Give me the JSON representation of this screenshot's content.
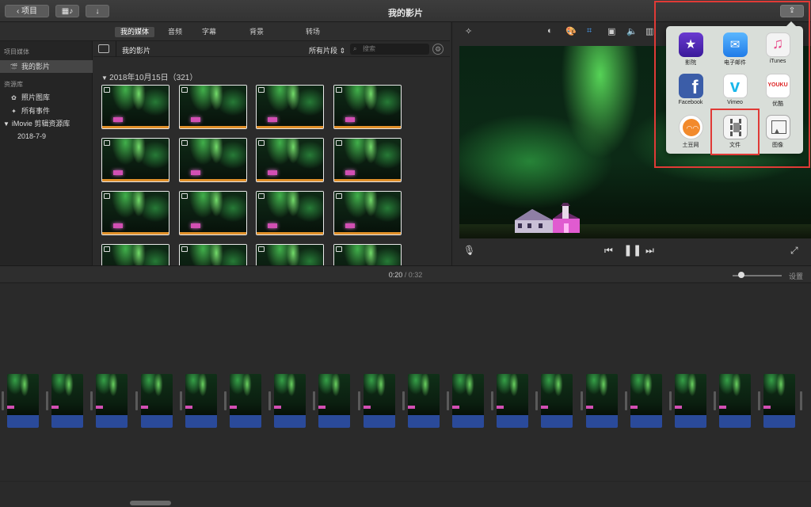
{
  "titlebar": {
    "back_label": "项目",
    "title": "我的影片"
  },
  "tabs": [
    {
      "label": "我的媒体",
      "active": true
    },
    {
      "label": "音频",
      "active": false
    },
    {
      "label": "字幕",
      "active": false
    },
    {
      "label": "背景",
      "active": false
    },
    {
      "label": "转场",
      "active": false
    }
  ],
  "sidebar": {
    "project_media_header": "项目媒体",
    "my_movie": "我的影片",
    "libraries_header": "资源库",
    "photos_library": "照片图库",
    "all_events": "所有事件",
    "imovie_library": "iMovie 剪辑资源库",
    "event_date": "2018-7-9"
  },
  "browser": {
    "title": "我的影片",
    "clip_filter": "所有片段",
    "search_placeholder": "搜索",
    "date_group": "2018年10月15日（321）"
  },
  "share": {
    "items": [
      {
        "label": "影院",
        "icon": "theater-icon"
      },
      {
        "label": "电子邮件",
        "icon": "mail-icon"
      },
      {
        "label": "iTunes",
        "icon": "itunes-icon"
      },
      {
        "label": "Facebook",
        "icon": "facebook-icon"
      },
      {
        "label": "Vimeo",
        "icon": "vimeo-icon"
      },
      {
        "label": "优酷",
        "icon": "youku-icon"
      },
      {
        "label": "土豆网",
        "icon": "tudou-icon"
      },
      {
        "label": "文件",
        "icon": "file-film-icon"
      },
      {
        "label": "图像",
        "icon": "image-icon"
      }
    ],
    "youku_logo_text": "YOUKU",
    "highlight_color": "#e03a36"
  },
  "timeline": {
    "current_time": "0:20",
    "separator": "/",
    "total_time": "0:32",
    "settings_label": "设置"
  }
}
